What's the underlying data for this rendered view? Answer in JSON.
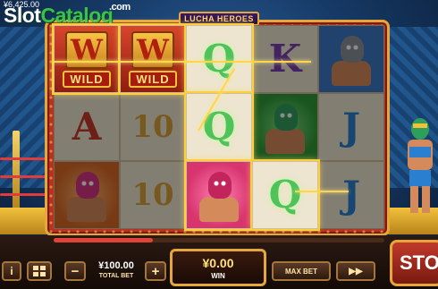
{
  "branding": {
    "logo_slot": "Slot",
    "logo_catalog": "Catalog",
    "logo_com": ".com"
  },
  "balance": "¥6,425.00",
  "game_title": "LUCHA HEROES",
  "reels": {
    "r1": [
      "WILD",
      "A",
      "luchador"
    ],
    "r2": [
      "WILD",
      "10",
      "10"
    ],
    "r3": [
      "Q",
      "Q",
      "luchador"
    ],
    "r4": [
      "K",
      "luchador",
      "Q"
    ],
    "r5": [
      "luchador",
      "J",
      "J"
    ]
  },
  "symbols": {
    "wild_letter": "W",
    "wild_label": "WILD",
    "a": "A",
    "ten": "10",
    "q": "Q",
    "k": "K",
    "j": "J"
  },
  "controls": {
    "info_label": "i",
    "minus_label": "−",
    "plus_label": "+",
    "total_bet_value": "¥100.00",
    "total_bet_label": "TOTAL BET",
    "win_value": "¥0.00",
    "win_label": "WIN",
    "max_bet_label": "MAX BET",
    "fast_label": "▶▶",
    "stop_label": "STOP"
  },
  "progress_fraction": 0.3,
  "colors": {
    "accent": "#e5a63a",
    "frame": "#b8321f",
    "win_glow": "#ffd54a"
  }
}
